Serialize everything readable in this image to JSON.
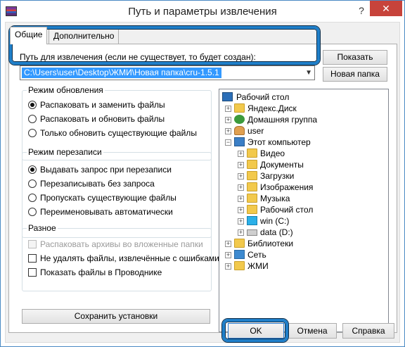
{
  "window": {
    "title": "Путь и параметры извлечения",
    "help_glyph": "?",
    "close_glyph": "✕"
  },
  "tabs": [
    {
      "label": "Общие",
      "active": true
    },
    {
      "label": "Дополнительно",
      "active": false
    }
  ],
  "path": {
    "label": "Путь для извлечения (если не существует, то будет создан):",
    "value": "C:\\Users\\user\\Desktop\\ЖМИ\\Новая папка\\cru-1.5.1"
  },
  "side_buttons": {
    "show": "Показать",
    "new_folder": "Новая папка"
  },
  "update_mode": {
    "title": "Режим обновления",
    "options": [
      {
        "label": "Распаковать и заменить файлы",
        "selected": true
      },
      {
        "label": "Распаковать и обновить файлы",
        "selected": false
      },
      {
        "label": "Только обновить существующие файлы",
        "selected": false
      }
    ]
  },
  "overwrite_mode": {
    "title": "Режим перезаписи",
    "options": [
      {
        "label": "Выдавать запрос при перезаписи",
        "selected": true
      },
      {
        "label": "Перезаписывать без запроса",
        "selected": false
      },
      {
        "label": "Пропускать существующие файлы",
        "selected": false
      },
      {
        "label": "Переименовывать автоматически",
        "selected": false
      }
    ]
  },
  "misc": {
    "title": "Разное",
    "options": [
      {
        "label": "Распаковать архивы во вложенные папки",
        "checked": false,
        "disabled": true
      },
      {
        "label": "Не удалять файлы, извлечённые с ошибками",
        "checked": false,
        "disabled": false
      },
      {
        "label": "Показать файлы в Проводнике",
        "checked": false,
        "disabled": false
      }
    ]
  },
  "save_settings": "Сохранить установки",
  "tree": [
    {
      "label": "Рабочий стол",
      "icon": "desktop-icon"
    },
    {
      "label": "Яндекс.Диск",
      "icon": "folder-icon"
    },
    {
      "label": "Домашняя группа",
      "icon": "homegroup-icon"
    },
    {
      "label": "user",
      "icon": "user-folder-icon"
    },
    {
      "label": "Этот компьютер",
      "icon": "computer-icon"
    },
    {
      "label": "Видео",
      "icon": "folder-icon"
    },
    {
      "label": "Документы",
      "icon": "folder-icon"
    },
    {
      "label": "Загрузки",
      "icon": "folder-icon"
    },
    {
      "label": "Изображения",
      "icon": "folder-icon"
    },
    {
      "label": "Музыка",
      "icon": "folder-icon"
    },
    {
      "label": "Рабочий стол",
      "icon": "folder-icon"
    },
    {
      "label": "win (C:)",
      "icon": "windows-drive-icon"
    },
    {
      "label": "data (D:)",
      "icon": "drive-icon"
    },
    {
      "label": "Библиотеки",
      "icon": "libraries-icon"
    },
    {
      "label": "Сеть",
      "icon": "network-icon"
    },
    {
      "label": "ЖМИ",
      "icon": "folder-icon"
    }
  ],
  "footer": {
    "ok": "OK",
    "cancel": "Отмена",
    "help": "Справка"
  },
  "colors": {
    "accent_highlight": "#1f7fc9",
    "selection": "#3399ff",
    "close_button": "#c7433b"
  }
}
